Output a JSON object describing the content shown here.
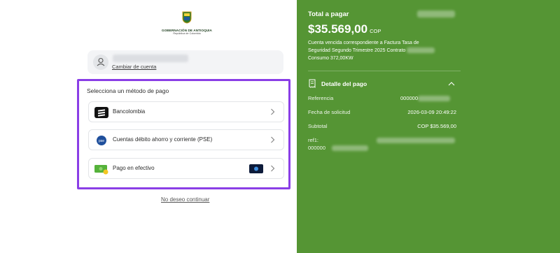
{
  "brand": {
    "org_name": "GOBERNACIÓN DE ANTIOQUIA",
    "org_sub": "República de Colombia"
  },
  "user": {
    "change_account": "Cambiar de cuenta"
  },
  "methods": {
    "title": "Selecciona un método de pago",
    "items": [
      {
        "label": "Bancolombia",
        "icon": "bancolombia-icon"
      },
      {
        "label": "Cuentas débito ahorro y corriente (PSE)",
        "icon": "pse-icon"
      },
      {
        "label": "Pago en efectivo",
        "icon": "cash-icon"
      }
    ],
    "quit_label": "No deseo continuar"
  },
  "summary": {
    "total_label": "Total a pagar",
    "amount": "$35.569,00",
    "currency": "COP",
    "description_1": "Cuenta vencida correspondiente a Factura Tasa de",
    "description_2": "Seguridad Segundo Trimestre 2025 Contrato",
    "description_3": "Consumo 372,00KW",
    "detail_title": "Detalle del pago",
    "rows": [
      {
        "label": "Referencia",
        "value": "000000"
      },
      {
        "label": "Fecha de solicitud",
        "value": "2026-03-09 20:49:22"
      },
      {
        "label": "Subtotal",
        "value": "COP $35.569,00"
      },
      {
        "label": "ref1:",
        "value": ""
      }
    ],
    "ref_second_line": "000000"
  },
  "colors": {
    "accent_green": "#559534",
    "highlight_purple": "#8a3ee6"
  }
}
